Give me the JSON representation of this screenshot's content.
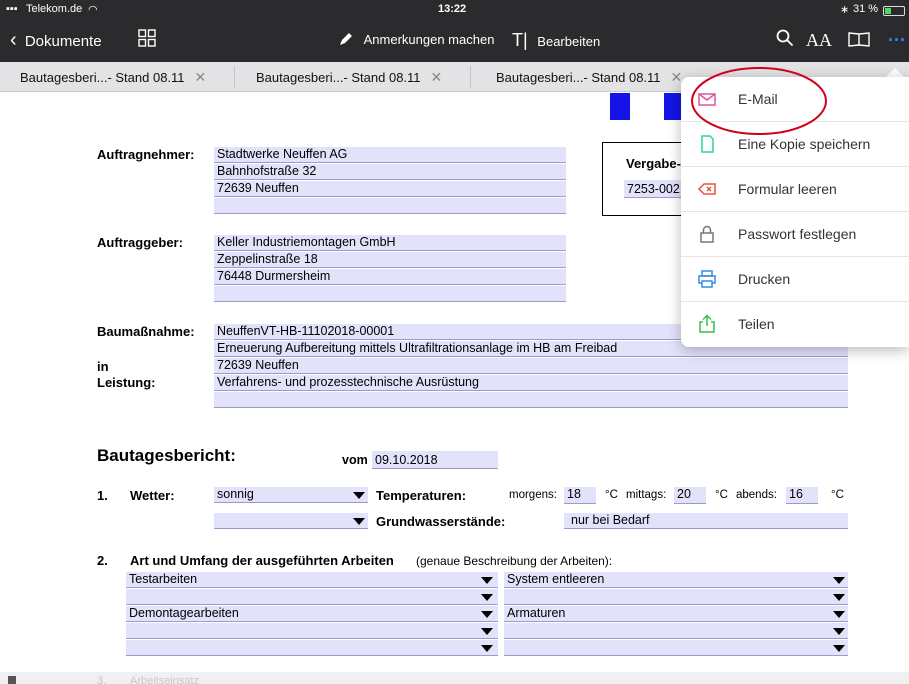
{
  "status_bar": {
    "carrier": "Telekom.de",
    "time": "13:22",
    "battery": "31 %"
  },
  "toolbar": {
    "back_label": "Dokumente",
    "annotate_label": "Anmerkungen machen",
    "edit_label": "Bearbeiten",
    "text_size_label": "AA"
  },
  "tabs": [
    {
      "label": "Bautagesberi...- Stand 08.11"
    },
    {
      "label": "Bautagesberi...- Stand 08.11"
    },
    {
      "label": "Bautagesberi...- Stand 08.11"
    }
  ],
  "menu": {
    "items": [
      {
        "label": "E-Mail",
        "icon": "mail-icon"
      },
      {
        "label": "Eine Kopie speichern",
        "icon": "copy-icon"
      },
      {
        "label": "Formular leeren",
        "icon": "clear-form-icon"
      },
      {
        "label": "Passwort festlegen",
        "icon": "lock-icon"
      },
      {
        "label": "Drucken",
        "icon": "printer-icon"
      },
      {
        "label": "Teilen",
        "icon": "share-icon"
      }
    ],
    "highlight_color": "#d0021b"
  },
  "document": {
    "contractor": {
      "label": "Auftragnehmer:",
      "lines": [
        "Stadtwerke Neuffen AG",
        "Bahnhofstraße 32",
        "72639 Neuffen",
        ""
      ]
    },
    "award": {
      "label": "Vergabe-",
      "value": "7253-002"
    },
    "client": {
      "label": "Auftraggeber:",
      "lines": [
        "Keller Industriemontagen GmbH",
        "Zeppelinstraße 18",
        "76448 Durmersheim",
        ""
      ]
    },
    "project": {
      "label": "Baumaßnahme:",
      "in_label": "in",
      "service_label": "Leistung:",
      "lines": [
        "NeuffenVT-HB-11102018-00001",
        "Erneuerung Aufbereitung mittels Ultrafiltrationsanlage im HB am Freibad",
        "72639 Neuffen",
        "Verfahrens- und prozesstechnische Ausrüstung",
        ""
      ]
    },
    "report": {
      "title": "Bautagesbericht:",
      "vom_label": "vom",
      "date": "09.10.2018"
    },
    "weather": {
      "number": "1.",
      "label": "Wetter:",
      "value": "sonnig",
      "value2": "",
      "temp_label": "Temperaturen:",
      "morning_label": "morgens:",
      "morning": "18",
      "unit1": "°C",
      "noon_label": "mittags:",
      "noon": "20",
      "unit2": "°C",
      "evening_label": "abends:",
      "evening": "16",
      "unit3": "°C",
      "groundwater_label": "Grundwasserstände:",
      "groundwater": "nur bei Bedarf"
    },
    "work": {
      "number": "2.",
      "label": "Art und Umfang der ausgeführten Arbeiten",
      "note": "(genaue Beschreibung der Arbeiten):",
      "left": [
        "Testarbeiten",
        "",
        "Demontagearbeiten",
        "",
        ""
      ],
      "right": [
        "System entleeren",
        "",
        "Armaturen",
        "",
        ""
      ]
    },
    "section3": {
      "number": "3.",
      "label": "Arbeitseinsatz"
    }
  }
}
